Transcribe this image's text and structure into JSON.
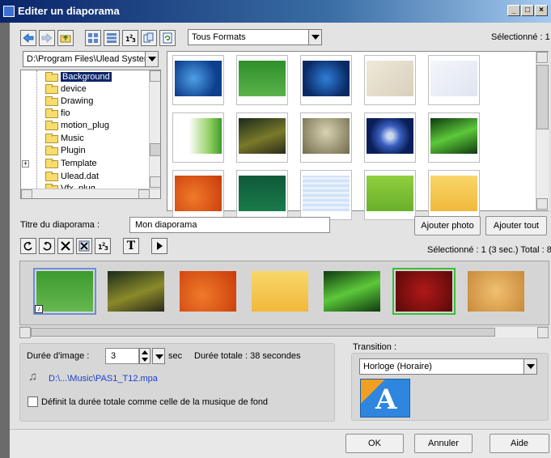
{
  "window": {
    "title": "Editer un diaporama",
    "controls": [
      "_",
      "□",
      "×"
    ]
  },
  "browser": {
    "format_select": "Tous Formats",
    "selected_count": "Sélectionné : 1",
    "path_select": "D:\\Program Files\\Ulead Systems",
    "tree_items": [
      {
        "label": "Background",
        "selected": true
      },
      {
        "label": "device"
      },
      {
        "label": "Drawing"
      },
      {
        "label": "fio"
      },
      {
        "label": "motion_plug"
      },
      {
        "label": "Music"
      },
      {
        "label": "Plugin"
      },
      {
        "label": "Template",
        "expandable": true
      },
      {
        "label": "Ulead.dat"
      },
      {
        "label": "Vfx_plug"
      }
    ],
    "expander_glyph": "+"
  },
  "slideshow": {
    "title_label": "Titre du diaporama :",
    "title_value": "Mon diaporama",
    "add_photo": "Ajouter photo",
    "add_all": "Ajouter tout",
    "strip_status": "Sélectionné : 1 (3 sec.)  Total : 8"
  },
  "toolbar2": {
    "order_glyph": "1 2 3",
    "text_glyph": "T"
  },
  "duration": {
    "label": "Durée d'image :",
    "value": "3",
    "unit": "sec",
    "total": "Durée totale : 38 secondes",
    "music_path": "D:\\...\\Music\\PAS1_T12.mpa",
    "checkbox_label": "Définit la durée totale comme celle de la musique de fond"
  },
  "transition": {
    "label": "Transition :",
    "value": "Horloge (Horaire)",
    "preview_letter": "A"
  },
  "footer": {
    "ok": "OK",
    "cancel": "Annuler",
    "help": "Aide"
  }
}
